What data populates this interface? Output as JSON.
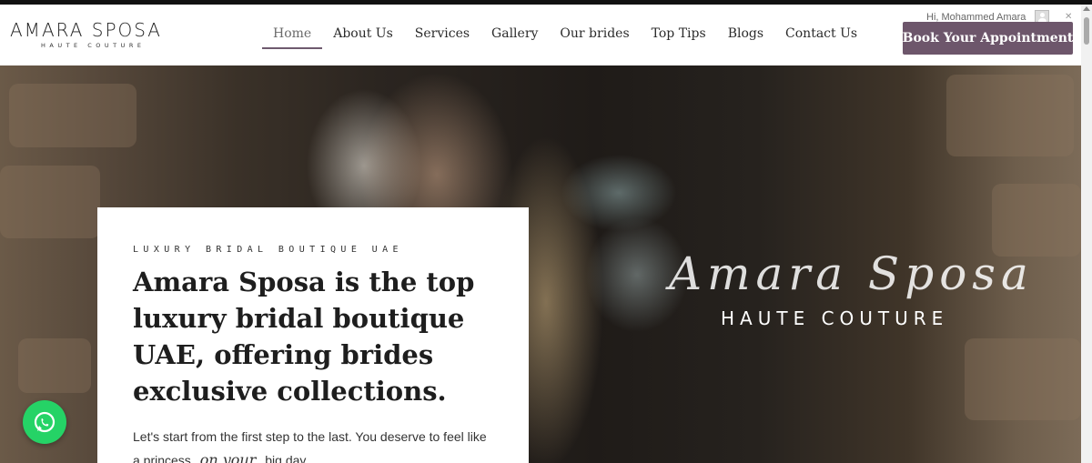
{
  "brand": {
    "name": "AMARA SPOSA",
    "tagline": "HAUTE COUTURE"
  },
  "nav": {
    "items": [
      {
        "label": "Home",
        "active": true
      },
      {
        "label": "About Us"
      },
      {
        "label": "Services"
      },
      {
        "label": "Gallery"
      },
      {
        "label": "Our brides"
      },
      {
        "label": "Top Tips"
      },
      {
        "label": "Blogs"
      },
      {
        "label": "Contact Us"
      }
    ]
  },
  "user": {
    "greeting": "Hi, Mohammed Amara",
    "icon": "user-avatar-icon"
  },
  "cta": {
    "label": "Book Your Appointment"
  },
  "colors": {
    "accent": "#6d566b",
    "whatsapp": "#25d366"
  },
  "hero": {
    "overlay_script": "Amara Sposa",
    "overlay_sub": "HAUTE COUTURE",
    "card": {
      "eyebrow": "LUXURY BRIDAL BOUTIQUE UAE",
      "headline": "Amara Sposa is the top luxury bridal boutique UAE, offering brides exclusive collections.",
      "intro_part1": "Let's start from the first step to the last. You deserve to feel like a princess",
      "intro_cursive": "on your",
      "intro_part2": "big day"
    }
  },
  "floating": {
    "whatsapp_icon": "whatsapp-icon"
  }
}
